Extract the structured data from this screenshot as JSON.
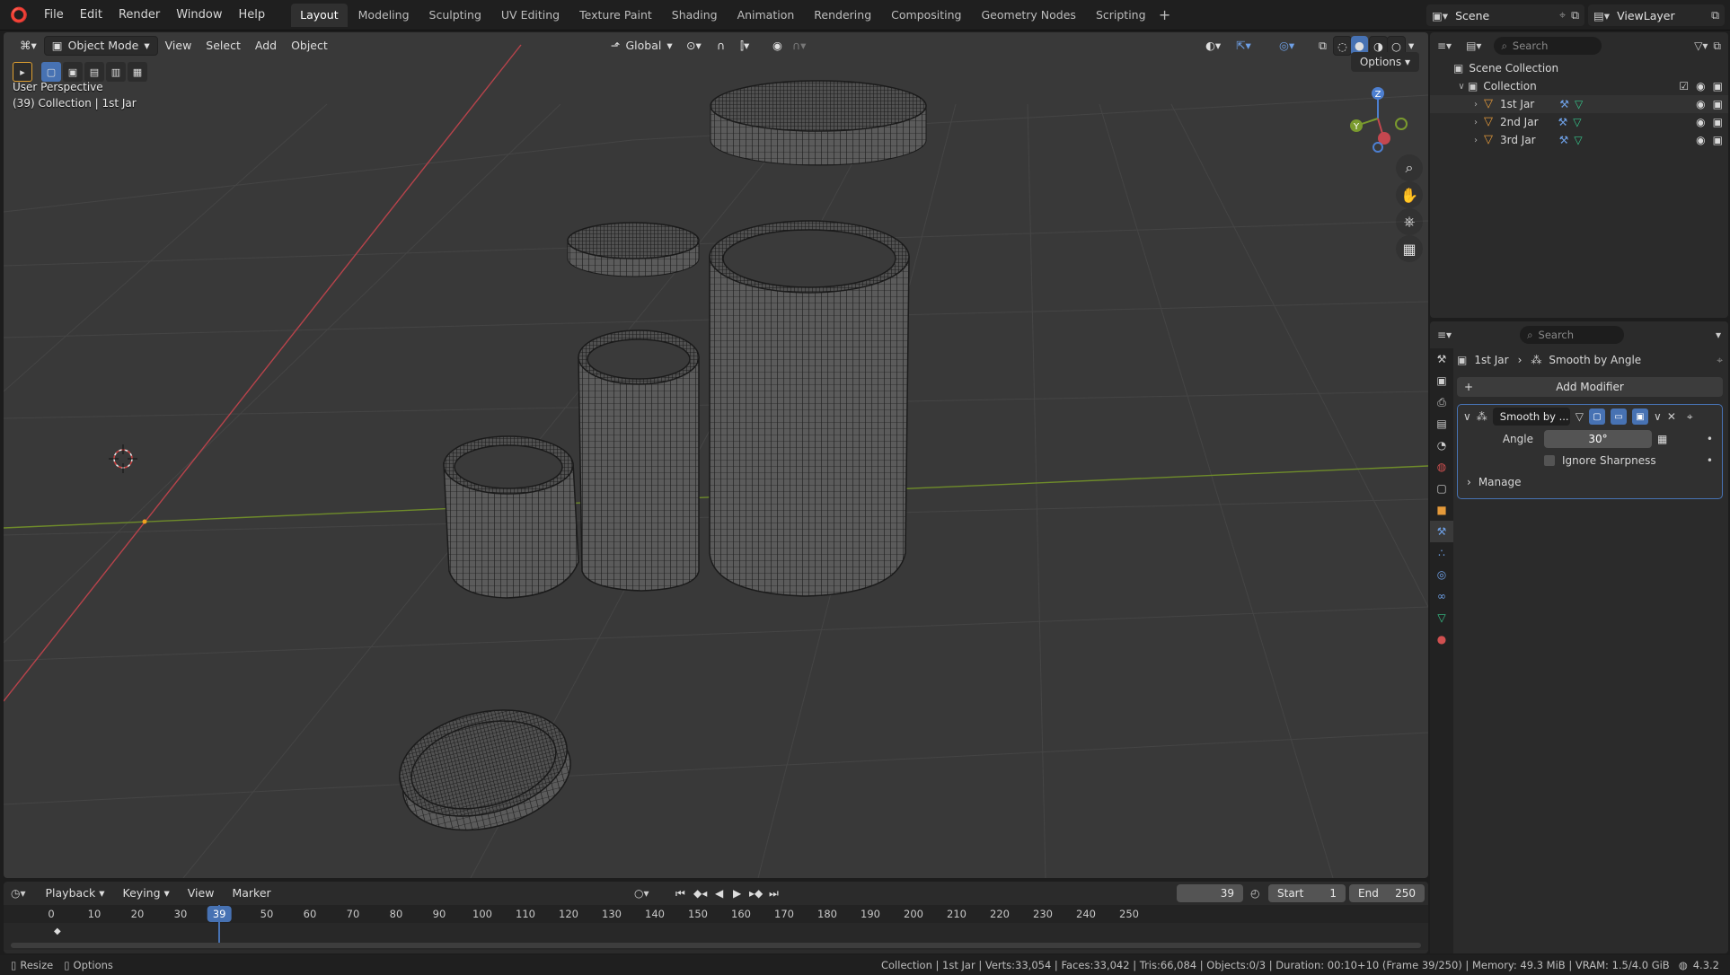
{
  "topbar": {
    "menus": [
      "File",
      "Edit",
      "Render",
      "Window",
      "Help"
    ],
    "workspaces": [
      "Layout",
      "Modeling",
      "Sculpting",
      "UV Editing",
      "Texture Paint",
      "Shading",
      "Animation",
      "Rendering",
      "Compositing",
      "Geometry Nodes",
      "Scripting"
    ],
    "active_workspace": "Layout",
    "scene": "Scene",
    "view_layer": "ViewLayer"
  },
  "viewport": {
    "mode": "Object Mode",
    "menus": [
      "View",
      "Select",
      "Add",
      "Object"
    ],
    "orientation": "Global",
    "options_label": "Options",
    "perspective_label": "User Perspective",
    "collection_label": "(39) Collection | 1st Jar",
    "gizmo_axes": [
      "Z",
      "Y",
      "X"
    ]
  },
  "outliner": {
    "search_placeholder": "Search",
    "scene_collection": "Scene Collection",
    "collection": "Collection",
    "objects": [
      "1st Jar",
      "2nd Jar",
      "3rd Jar"
    ]
  },
  "properties": {
    "search_placeholder": "Search",
    "breadcrumb_object": "1st Jar",
    "breadcrumb_modifier": "Smooth by Angle",
    "add_modifier_label": "Add Modifier",
    "modifier": {
      "name": "Smooth by ...",
      "angle_label": "Angle",
      "angle_value": "30°",
      "ignore_sharpness_label": "Ignore Sharpness",
      "ignore_sharpness_checked": false,
      "manage_label": "Manage"
    }
  },
  "timeline": {
    "menus": [
      "Playback",
      "Keying",
      "View",
      "Marker"
    ],
    "current_frame": "39",
    "start_label": "Start",
    "start_value": "1",
    "end_label": "End",
    "end_value": "250",
    "ruler_ticks": [
      "0",
      "10",
      "20",
      "30",
      "50",
      "60",
      "70",
      "80",
      "90",
      "100",
      "110",
      "120",
      "130",
      "140",
      "150",
      "160",
      "170",
      "180",
      "190",
      "200",
      "210",
      "220",
      "230",
      "240",
      "250"
    ]
  },
  "statusbar": {
    "left_resize": "Resize",
    "left_options": "Options",
    "stats": "Collection | 1st Jar | Verts:33,054 | Faces:33,042 | Tris:66,084 | Objects:0/3 | Duration: 00:10+10 (Frame 39/250) | Memory: 49.3 MiB | VRAM: 1.5/4.0 GiB",
    "version": "4.3.2"
  },
  "colors": {
    "accent": "#4772b3",
    "viewport_bg": "#393939",
    "panel_bg": "#2b2b2b",
    "x_axis": "#c4474f",
    "y_axis": "#7a9a2e",
    "object_orange": "#e59a3a"
  }
}
